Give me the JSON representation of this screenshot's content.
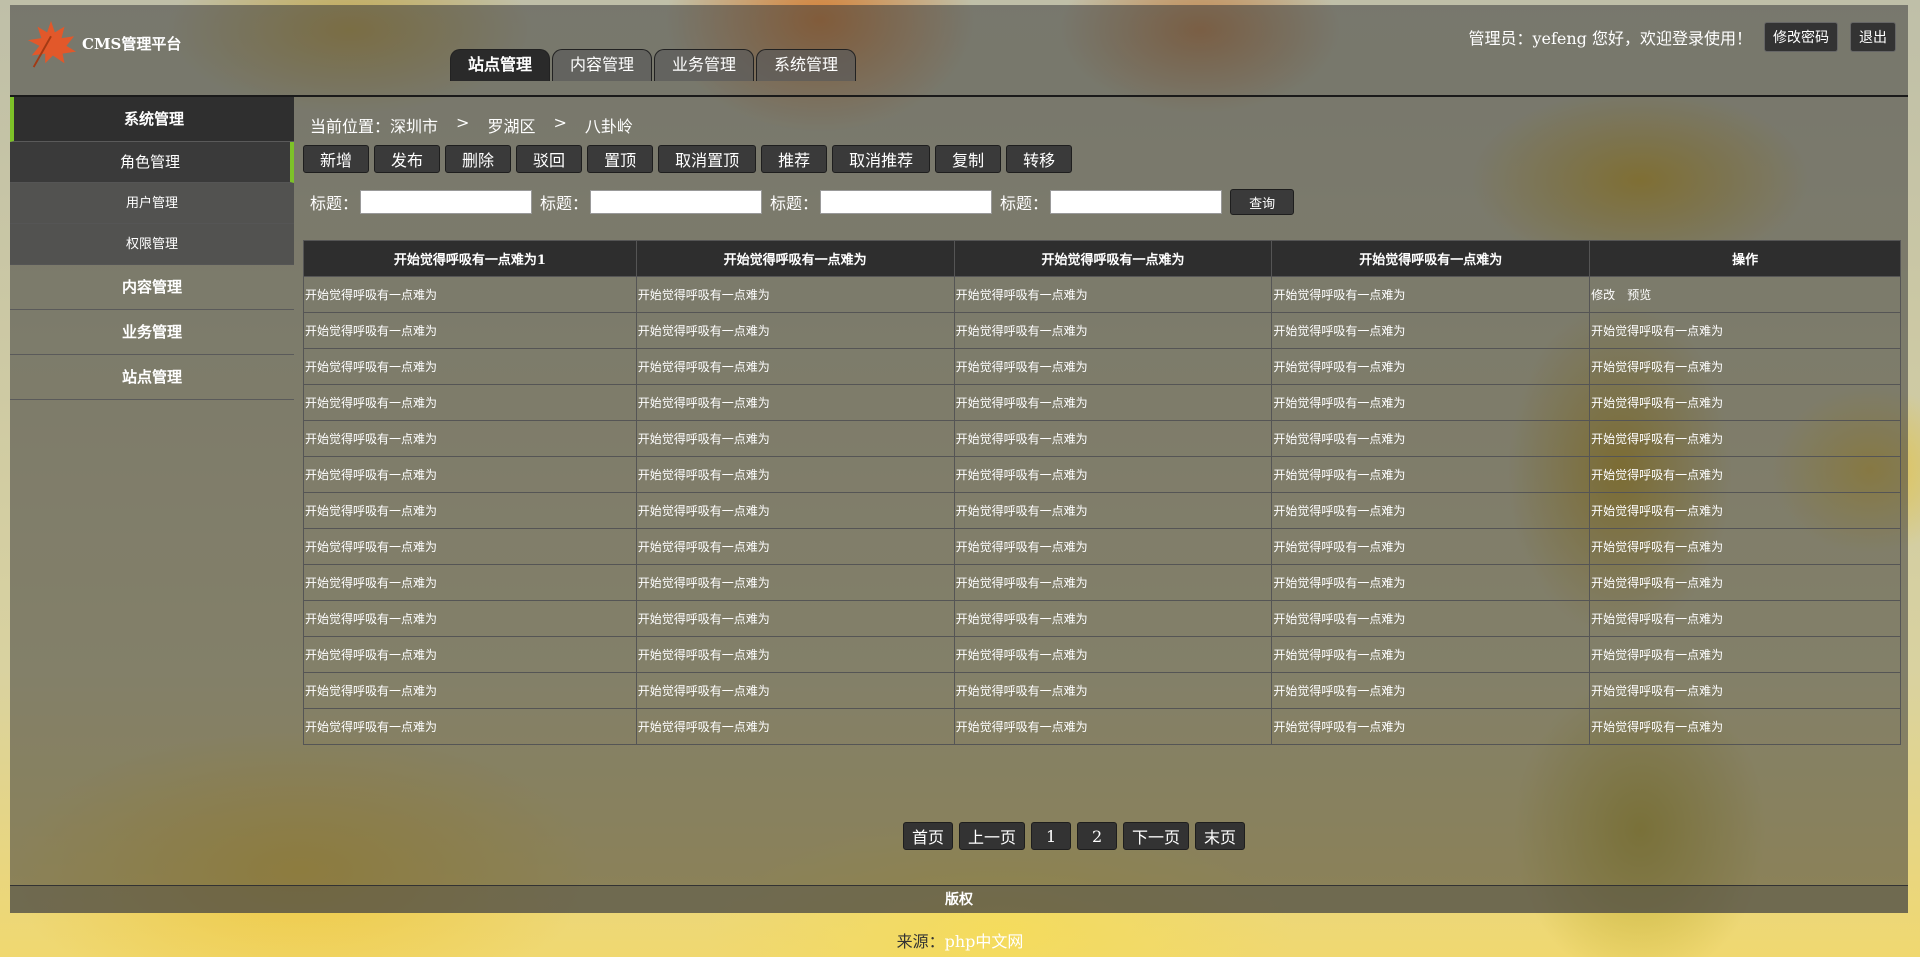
{
  "app": {
    "title": "CMS管理平台",
    "logo_icon": "maple-leaf-icon"
  },
  "top_nav": {
    "tabs": [
      "站点管理",
      "内容管理",
      "业务管理",
      "系统管理"
    ],
    "active": 0
  },
  "user": {
    "welcome": "管理员：yefeng 您好，欢迎登录使用！",
    "change_password": "修改密码",
    "logout": "退出"
  },
  "sidebar": {
    "groups": [
      "系统管理",
      "内容管理",
      "业务管理",
      "站点管理"
    ],
    "sub_items": [
      "角色管理",
      "用户管理",
      "权限管理"
    ],
    "accent_color": "#7dc128"
  },
  "breadcrumb": {
    "prefix": "当前位置：",
    "items": [
      "深圳市",
      "罗湖区",
      "八卦岭"
    ],
    "separator": ">"
  },
  "toolbar": {
    "buttons": [
      "新增",
      "发布",
      "删除",
      "驳回",
      "置顶",
      "取消置顶",
      "推荐",
      "取消推荐",
      "复制",
      "转移"
    ]
  },
  "search": {
    "label": "标题：",
    "button": "查询"
  },
  "table": {
    "headers": [
      "开始觉得呼吸有一点难为1",
      "开始觉得呼吸有一点难为",
      "开始觉得呼吸有一点难为",
      "开始觉得呼吸有一点难为",
      "操作"
    ],
    "cell_text": "开始觉得呼吸有一点难为",
    "first_row_ops": [
      "修改",
      "预览"
    ],
    "row_count": 13
  },
  "pager": {
    "buttons": [
      "首页",
      "上一页",
      "1",
      "2",
      "下一页",
      "末页"
    ]
  },
  "footer": {
    "copyright": "版权"
  },
  "source": {
    "label": "来源：",
    "site": "php中文网"
  }
}
